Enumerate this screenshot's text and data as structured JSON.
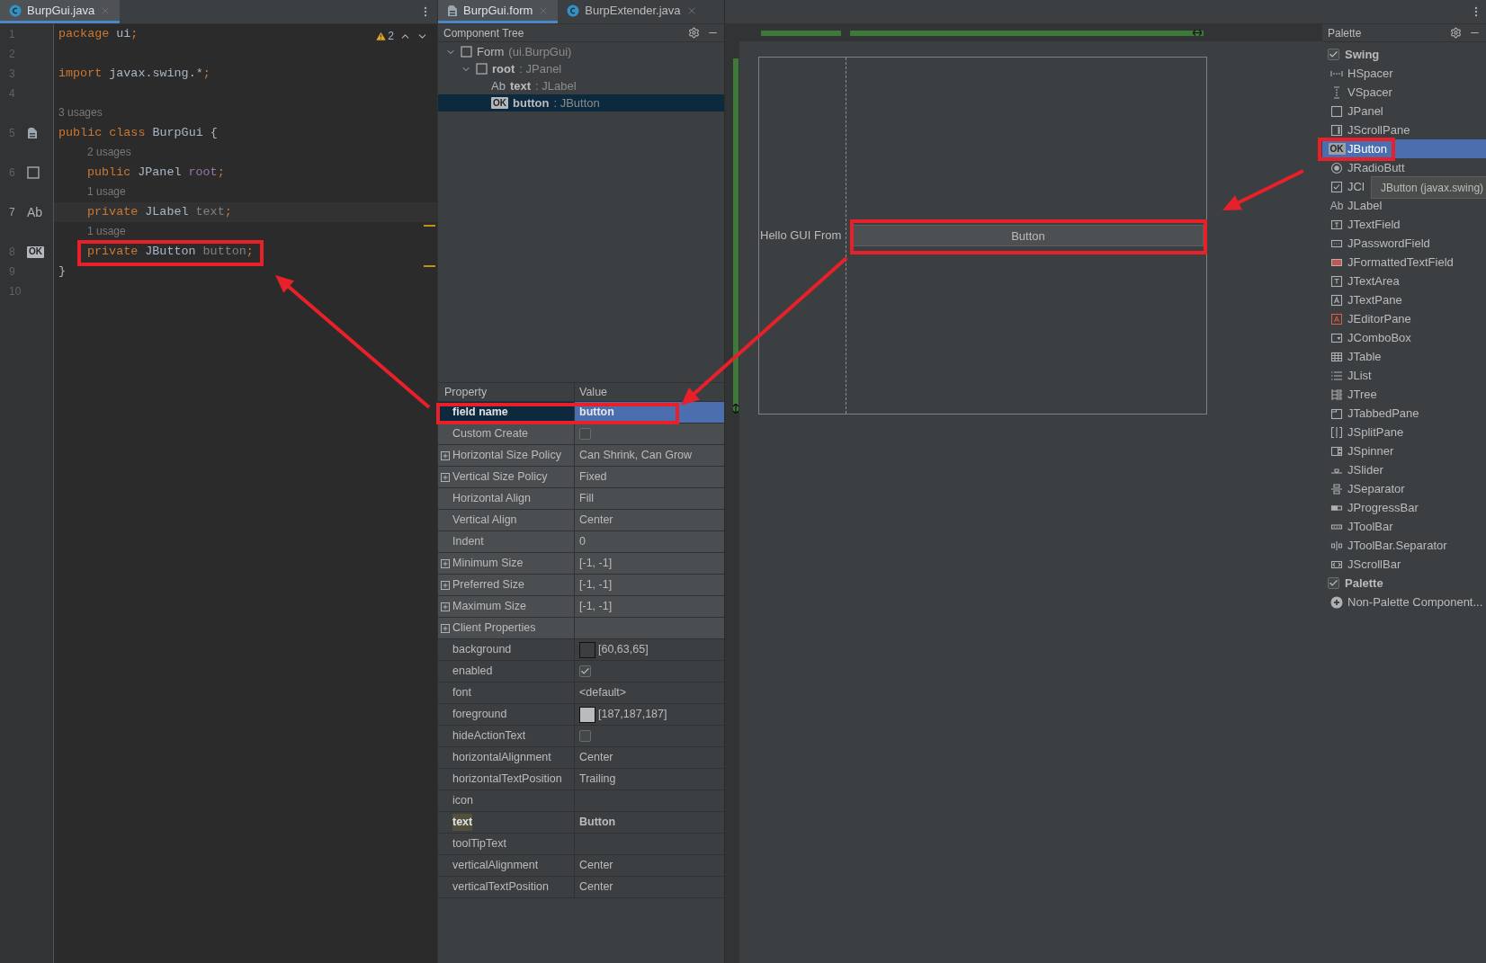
{
  "editor": {
    "tabs": [
      {
        "label": "BurpGui.java",
        "kind": "class",
        "selected": true
      }
    ],
    "warnings": {
      "count": "2"
    },
    "rows": [
      {
        "kind": "code",
        "number": "1",
        "current": false,
        "tokens": [
          {
            "text": "package",
            "kind": "keyword"
          },
          {
            "text": " ui",
            "kind": "plain"
          },
          {
            "text": ";",
            "kind": "keyword"
          }
        ]
      },
      {
        "kind": "code",
        "number": "2",
        "current": false,
        "tokens": []
      },
      {
        "kind": "code",
        "number": "3",
        "current": false,
        "tokens": [
          {
            "text": "import",
            "kind": "keyword"
          },
          {
            "text": " javax.swing.*",
            "kind": "plain"
          },
          {
            "text": ";",
            "kind": "keyword"
          }
        ]
      },
      {
        "kind": "code",
        "number": "4",
        "current": false,
        "tokens": []
      },
      {
        "kind": "hint",
        "text": "3 usages",
        "indented": false
      },
      {
        "kind": "code",
        "number": "5",
        "current": false,
        "gutter": {
          "kind": "form"
        },
        "tokens": [
          {
            "text": "public class",
            "kind": "keyword"
          },
          {
            "text": " BurpGui {",
            "kind": "plain"
          }
        ]
      },
      {
        "kind": "hint",
        "text": "2 usages",
        "indented": true
      },
      {
        "kind": "code",
        "number": "6",
        "current": false,
        "indented": true,
        "gutter": {
          "kind": "panel"
        },
        "tokens": [
          {
            "text": "public",
            "kind": "keyword"
          },
          {
            "text": " JPanel ",
            "kind": "plain"
          },
          {
            "text": "root",
            "kind": "field"
          },
          {
            "text": ";",
            "kind": "keyword"
          }
        ]
      },
      {
        "kind": "hint",
        "text": "1 usage",
        "indented": true
      },
      {
        "kind": "code",
        "number": "7",
        "current": true,
        "indented": true,
        "gutter": {
          "kind": "label",
          "badge": "Ab"
        },
        "tokens": [
          {
            "text": "private",
            "kind": "keyword"
          },
          {
            "text": " JLabel ",
            "kind": "plain"
          },
          {
            "text": "text",
            "kind": "unused"
          },
          {
            "text": ";",
            "kind": "keyword"
          }
        ]
      },
      {
        "kind": "hint",
        "text": "1 usage",
        "indented": true
      },
      {
        "kind": "code",
        "number": "8",
        "current": false,
        "indented": true,
        "gutter": {
          "kind": "button",
          "badge": "OK"
        },
        "tokens": [
          {
            "text": "private",
            "kind": "keyword"
          },
          {
            "text": " JButton ",
            "kind": "plain"
          },
          {
            "text": "button",
            "kind": "unused"
          },
          {
            "text": ";",
            "kind": "keyword"
          }
        ]
      },
      {
        "kind": "code",
        "number": "9",
        "current": false,
        "tokens": [
          {
            "text": "}",
            "kind": "plain"
          }
        ]
      },
      {
        "kind": "code",
        "number": "10",
        "current": false,
        "tokens": []
      }
    ]
  },
  "form_tabs": [
    {
      "label": "BurpGui.form",
      "kind": "form",
      "selected": true
    },
    {
      "label": "BurpExtender.java",
      "kind": "class",
      "selected": false
    }
  ],
  "component_tree": {
    "title": "Component Tree",
    "items": [
      {
        "kind": "form",
        "name": "Form",
        "type": "(ui.BurpGui)",
        "expanded": true,
        "selected": false,
        "children": [
          {
            "kind": "panel",
            "name": "root",
            "type": ": JPanel",
            "expanded": true,
            "selected": false,
            "children": [
              {
                "kind": "label",
                "badge": "Ab",
                "name": "text",
                "type": ": JLabel",
                "selected": false
              },
              {
                "kind": "button",
                "badge": "OK",
                "name": "button",
                "type": ": JButton",
                "selected": true
              }
            ]
          }
        ]
      }
    ]
  },
  "properties": {
    "columns": [
      "Property",
      "Value"
    ],
    "layout": [
      {
        "name": "field name",
        "kind": "text",
        "value": "button",
        "expandable": false,
        "selected": true,
        "modified": true
      },
      {
        "name": "Custom Create",
        "kind": "checkbox",
        "checked": false,
        "expandable": false,
        "selected": false,
        "modified": false
      },
      {
        "name": "Horizontal Size Policy",
        "kind": "text",
        "value": "Can Shrink, Can Grow",
        "expandable": true,
        "selected": false,
        "modified": false
      },
      {
        "name": "Vertical Size Policy",
        "kind": "text",
        "value": "Fixed",
        "expandable": true,
        "selected": false,
        "modified": false
      },
      {
        "name": "Horizontal Align",
        "kind": "text",
        "value": "Fill",
        "expandable": false,
        "selected": false,
        "modified": false
      },
      {
        "name": "Vertical Align",
        "kind": "text",
        "value": "Center",
        "expandable": false,
        "selected": false,
        "modified": false
      },
      {
        "name": "Indent",
        "kind": "text",
        "value": "0",
        "expandable": false,
        "selected": false,
        "modified": false
      },
      {
        "name": "Minimum Size",
        "kind": "text",
        "value": "[-1, -1]",
        "expandable": true,
        "selected": false,
        "modified": false
      },
      {
        "name": "Preferred Size",
        "kind": "text",
        "value": "[-1, -1]",
        "expandable": true,
        "selected": false,
        "modified": false
      },
      {
        "name": "Maximum Size",
        "kind": "text",
        "value": "[-1, -1]",
        "expandable": true,
        "selected": false,
        "modified": false
      },
      {
        "name": "Client Properties",
        "kind": "text",
        "expandable": true,
        "selected": false,
        "modified": false
      }
    ],
    "component": [
      {
        "name": "background",
        "kind": "color",
        "color": "#3c3f41",
        "value": "[60,63,65]",
        "modified": false,
        "highlighted": false
      },
      {
        "name": "enabled",
        "kind": "checkbox",
        "checked": true,
        "modified": false,
        "highlighted": false
      },
      {
        "name": "font",
        "kind": "text",
        "value": "<default>",
        "modified": false,
        "highlighted": false
      },
      {
        "name": "foreground",
        "kind": "color",
        "color": "#bbbbbb",
        "value": "[187,187,187]",
        "modified": false,
        "highlighted": false
      },
      {
        "name": "hideActionText",
        "kind": "checkbox",
        "checked": false,
        "modified": false,
        "highlighted": false
      },
      {
        "name": "horizontalAlignment",
        "kind": "text",
        "value": "Center",
        "modified": false,
        "highlighted": false
      },
      {
        "name": "horizontalTextPosition",
        "kind": "text",
        "value": "Trailing",
        "modified": false,
        "highlighted": false
      },
      {
        "name": "icon",
        "kind": "text",
        "modified": false,
        "highlighted": false
      },
      {
        "name": "text",
        "kind": "text",
        "value": "Button",
        "modified": true,
        "highlighted": true
      },
      {
        "name": "toolTipText",
        "kind": "text",
        "modified": false,
        "highlighted": false
      },
      {
        "name": "verticalAlignment",
        "kind": "text",
        "value": "Center",
        "modified": false,
        "highlighted": false
      },
      {
        "name": "verticalTextPosition",
        "kind": "text",
        "value": "Center",
        "modified": false,
        "highlighted": false
      }
    ]
  },
  "designer": {
    "label": "Hello GUI From",
    "button": "Button"
  },
  "palette": {
    "title": "Palette",
    "items": [
      {
        "kind": "group",
        "label": "Swing",
        "checked": true,
        "selected": false
      },
      {
        "kind": "hspacer",
        "label": "HSpacer",
        "selected": false
      },
      {
        "kind": "vspacer",
        "label": "VSpacer",
        "selected": false
      },
      {
        "kind": "panel",
        "label": "JPanel",
        "selected": false
      },
      {
        "kind": "scrollpane",
        "label": "JScrollPane",
        "selected": false
      },
      {
        "kind": "button",
        "badge": "OK",
        "label": "JButton",
        "selected": true
      },
      {
        "kind": "radio",
        "label": "JRadioButt",
        "selected": false
      },
      {
        "kind": "checkbox",
        "label": "JCl",
        "selected": false
      },
      {
        "kind": "label",
        "badge": "Ab",
        "label": "JLabel",
        "selected": false
      },
      {
        "kind": "textfield",
        "label": "JTextField",
        "selected": false
      },
      {
        "kind": "password",
        "label": "JPasswordField",
        "selected": false
      },
      {
        "kind": "formatted",
        "label": "JFormattedTextField",
        "selected": false
      },
      {
        "kind": "textarea",
        "label": "JTextArea",
        "selected": false
      },
      {
        "kind": "textpane",
        "label": "JTextPane",
        "selected": false
      },
      {
        "kind": "editorpane",
        "label": "JEditorPane",
        "selected": false
      },
      {
        "kind": "combobox",
        "label": "JComboBox",
        "selected": false
      },
      {
        "kind": "table",
        "label": "JTable",
        "selected": false
      },
      {
        "kind": "list",
        "label": "JList",
        "selected": false
      },
      {
        "kind": "tree",
        "label": "JTree",
        "selected": false
      },
      {
        "kind": "tabbedpane",
        "label": "JTabbedPane",
        "selected": false
      },
      {
        "kind": "splitpane",
        "label": "JSplitPane",
        "selected": false
      },
      {
        "kind": "spinner",
        "label": "JSpinner",
        "selected": false
      },
      {
        "kind": "slider",
        "label": "JSlider",
        "selected": false
      },
      {
        "kind": "separator",
        "label": "JSeparator",
        "selected": false
      },
      {
        "kind": "progressbar",
        "label": "JProgressBar",
        "selected": false
      },
      {
        "kind": "toolbar",
        "label": "JToolBar",
        "selected": false
      },
      {
        "kind": "toolbarseparator",
        "label": "JToolBar.Separator",
        "selected": false
      },
      {
        "kind": "scrollbar",
        "label": "JScrollBar",
        "selected": false
      },
      {
        "kind": "group",
        "label": "Palette",
        "checked": true,
        "selected": false
      },
      {
        "kind": "nonpalette",
        "label": "Non-Palette Component...",
        "selected": false
      }
    ],
    "tooltip": "JButton (javax.swing)"
  }
}
